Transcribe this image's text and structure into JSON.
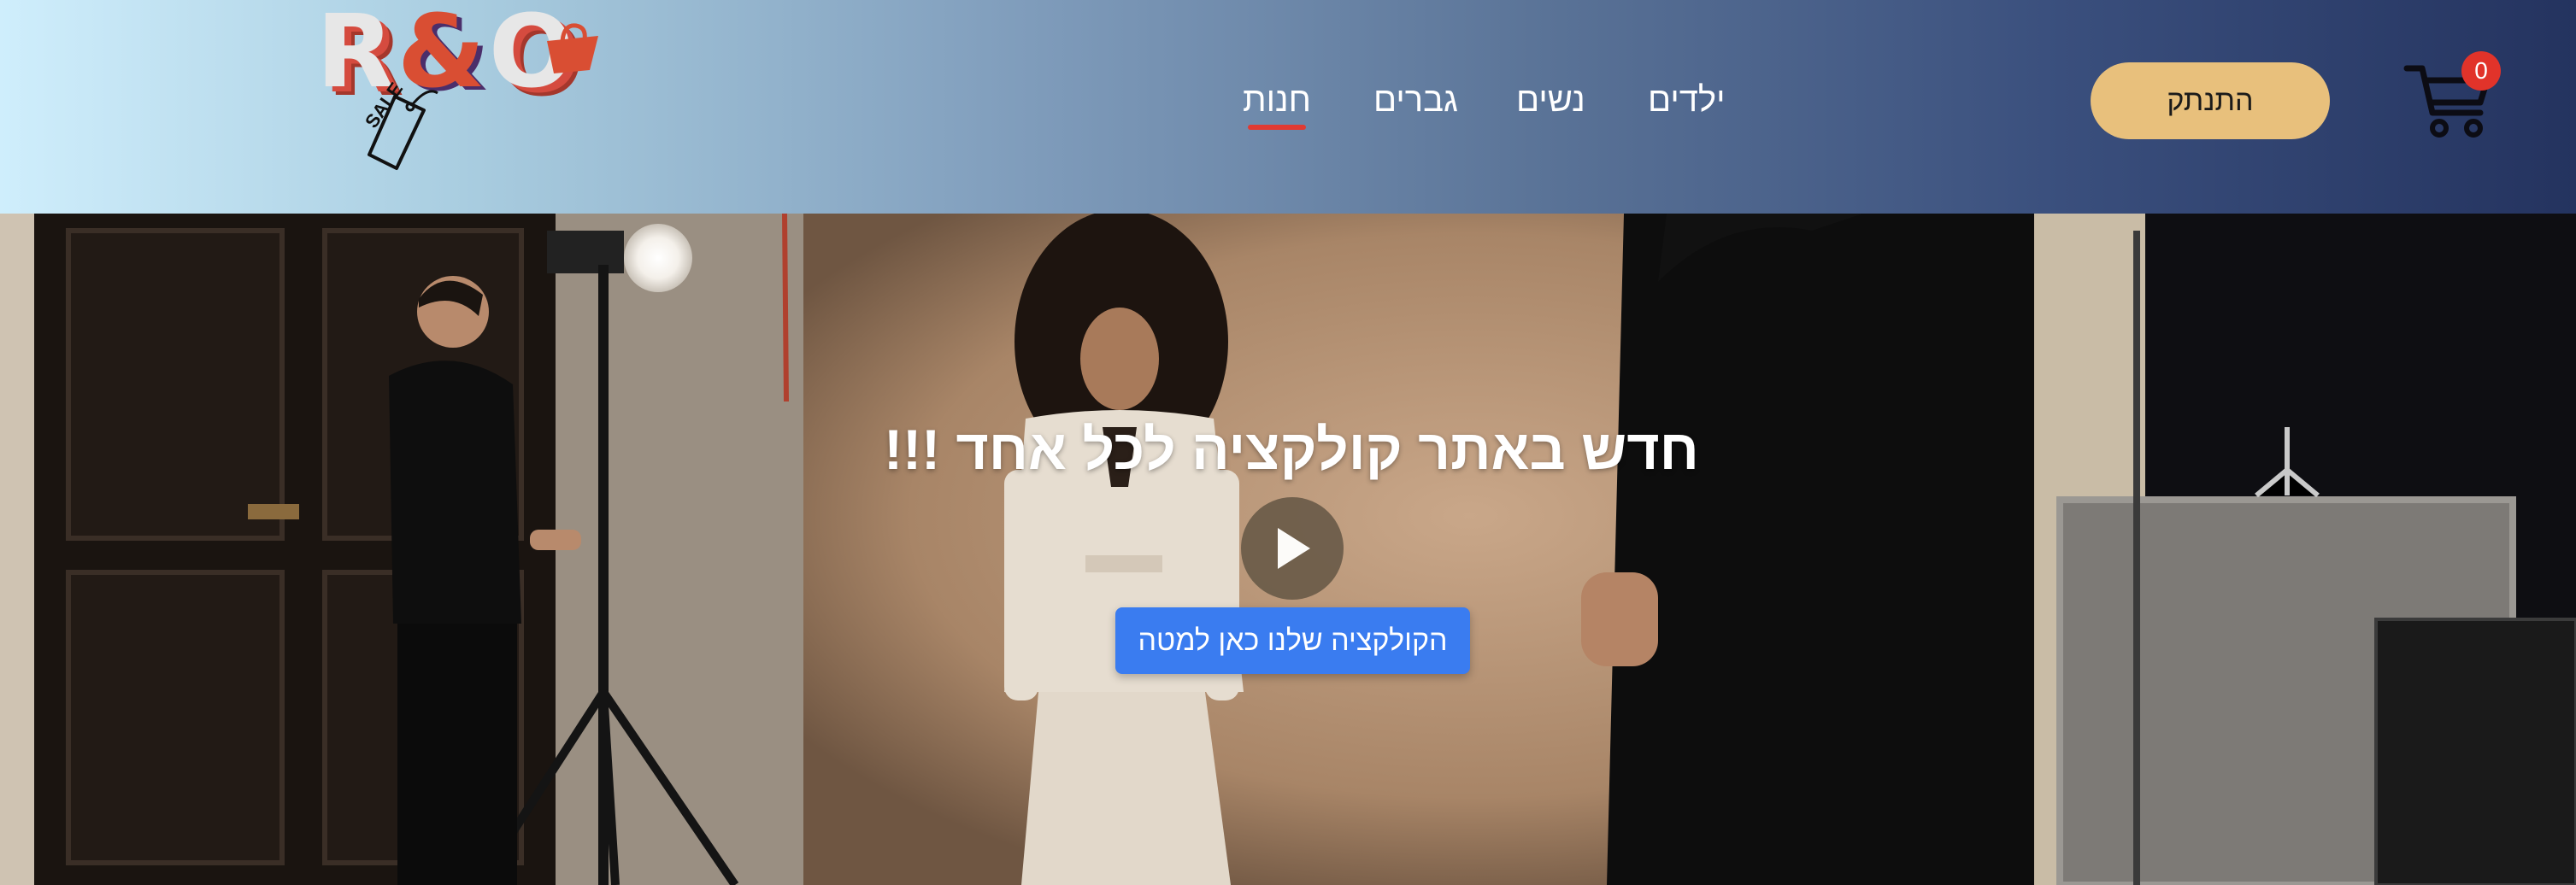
{
  "logo": {
    "text_r": "R",
    "text_amp": "&",
    "text_o": "O",
    "tag_text": "SALE"
  },
  "nav": {
    "items": [
      {
        "label": "חנות",
        "active": true
      },
      {
        "label": "גברים",
        "active": false
      },
      {
        "label": "נשים",
        "active": false
      },
      {
        "label": "ילדים",
        "active": false
      }
    ]
  },
  "header": {
    "logout_label": "התנתק",
    "cart_count": "0"
  },
  "hero": {
    "title": "חדש באתר קולקציה לכל אחד !!!",
    "cta_label": "הקולקציה שלנו כאן למטה"
  },
  "colors": {
    "accent_blue": "#3a7cf0",
    "logout_bg": "#e8c07c",
    "badge_red": "#e1332a",
    "active_underline": "#e13a32"
  },
  "icons": [
    "cart-icon",
    "play-icon",
    "shopping-bag-icon",
    "price-tag-icon"
  ]
}
